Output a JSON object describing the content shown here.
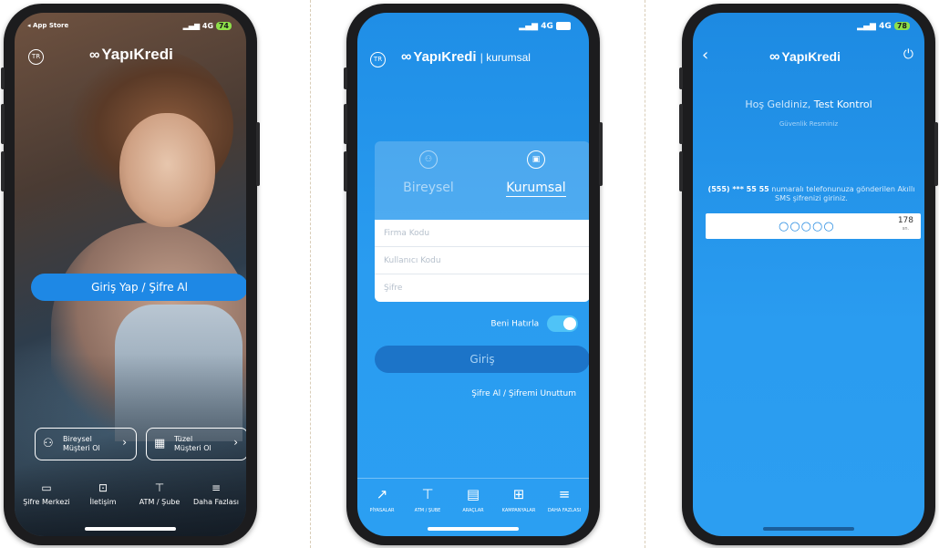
{
  "colors": {
    "brand_blue": "#2a9cf0",
    "button_blue": "#1e88e5",
    "battery_green": "#8ee04a"
  },
  "phone1": {
    "status_back": "◂ App Store",
    "status_net": "4G",
    "status_battery": "74",
    "lang": "TR",
    "logo_text": "YapıKredi",
    "login_button": "Giriş Yap / Şifre Al",
    "customer_cards": [
      {
        "line1": "Bireysel",
        "line2": "Müşteri Ol",
        "icon": "person-icon"
      },
      {
        "line1": "Tüzel",
        "line2": "Müşteri Ol",
        "icon": "building-icon"
      }
    ],
    "nav": [
      {
        "label": "Şifre Merkezi",
        "icon": "password-icon"
      },
      {
        "label": "İletişim",
        "icon": "chat-icon"
      },
      {
        "label": "ATM / Şube",
        "icon": "atm-icon"
      },
      {
        "label": "Daha Fazlası",
        "icon": "menu-icon"
      }
    ]
  },
  "phone2": {
    "status_net": "4G",
    "lang": "TR",
    "logo_text": "YapıKredi",
    "logo_sub": "kurumsal",
    "tabs": [
      {
        "label": "Bireysel",
        "icon": "person-icon",
        "active": false
      },
      {
        "label": "Kurumsal",
        "icon": "briefcase-icon",
        "active": true
      }
    ],
    "fields": {
      "firm_code": "Firma Kodu",
      "user_code": "Kullanıcı Kodu",
      "password": "Şifre"
    },
    "remember_label": "Beni Hatırla",
    "remember_on": true,
    "login_button": "Giriş",
    "forgot_link": "Şifre Al / Şifremi Unuttum",
    "nav": [
      {
        "label": "PİYASALAR",
        "icon": "chart-icon"
      },
      {
        "label": "ATM / ŞUBE",
        "icon": "atm-icon"
      },
      {
        "label": "ARAÇLAR",
        "icon": "tools-icon"
      },
      {
        "label": "KAMPANYALAR",
        "icon": "gift-icon"
      },
      {
        "label": "DAHA FAZLASI",
        "icon": "menu-icon"
      }
    ]
  },
  "phone3": {
    "status_net": "4G",
    "status_battery": "78",
    "logo_text": "YapıKredi",
    "welcome_prefix": "Hoş Geldiniz,",
    "welcome_name": "Test Kontrol",
    "security_label": "Güvenlik Resminiz",
    "sms_phone": "(555) *** 55 55",
    "sms_text": "numaralı telefonunuza gönderilen Akıllı SMS şifrenizi giriniz.",
    "otp_placeholder": "○○○○○",
    "countdown": "178",
    "countdown_unit": "sn."
  }
}
